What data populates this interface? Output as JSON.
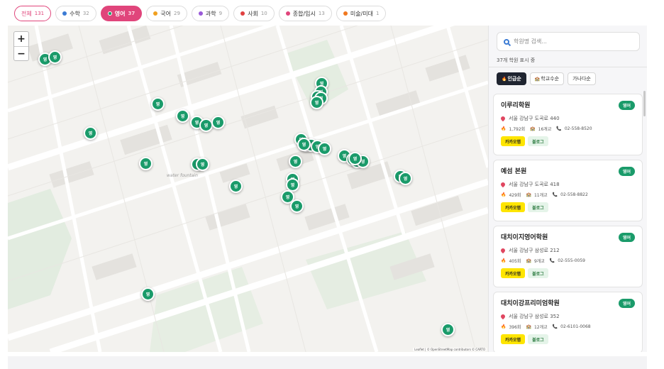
{
  "filters": [
    {
      "label": "전체",
      "count": "131",
      "color": ""
    },
    {
      "label": "수학",
      "count": "32",
      "color": "#3b7bd4"
    },
    {
      "label": "영어",
      "count": "37",
      "color": "#1a9b6a"
    },
    {
      "label": "국어",
      "count": "29",
      "color": "#f0a020"
    },
    {
      "label": "과학",
      "count": "9",
      "color": "#9a5ad8"
    },
    {
      "label": "사회",
      "count": "10",
      "color": "#e04040"
    },
    {
      "label": "종합/입시",
      "count": "13",
      "color": "#e0457b"
    },
    {
      "label": "미술/미대",
      "count": "1",
      "color": "#f07820"
    }
  ],
  "map": {
    "zoom_in": "+",
    "zoom_out": "−",
    "marker_label": "영",
    "place_label": "water fountain",
    "attribution": "Leaflet | © OpenStreetMap contributors © CARTO"
  },
  "panel": {
    "search_placeholder": "학원명 검색...",
    "count_text": "37개 학원 표시 중",
    "sort_options": [
      "인급순",
      "학교수순",
      "가나다순"
    ],
    "cards": [
      {
        "name": "이루리학원",
        "badge": "영어",
        "address": "서울 강남구 도곡로 440",
        "views": "1,792회",
        "schools": "16개교",
        "phone": "02-558-8520",
        "kakao": "카카오맵",
        "blog": "블로그"
      },
      {
        "name": "예섬 본원",
        "badge": "영어",
        "address": "서울 강남구 도곡로 418",
        "views": "429회",
        "schools": "11개교",
        "phone": "02-558-8822",
        "kakao": "카카오맵",
        "blog": "블로그"
      },
      {
        "name": "대치이지영어학원",
        "badge": "영어",
        "address": "서울 강남구 삼성로 212",
        "views": "405회",
        "schools": "9개교",
        "phone": "02-555-0059",
        "kakao": "카카오맵",
        "blog": "블로그"
      },
      {
        "name": "대치이강프리미엄학원",
        "badge": "영어",
        "address": "서울 강남구 삼성로 352",
        "views": "396회",
        "schools": "12개교",
        "phone": "02-6101-0068",
        "kakao": "카카오맵",
        "blog": "블로그"
      }
    ]
  }
}
